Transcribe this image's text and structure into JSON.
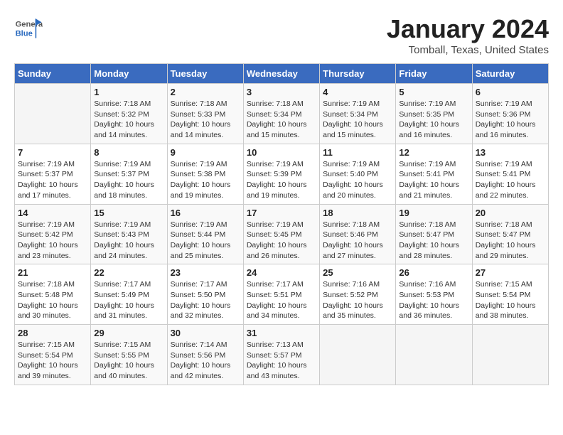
{
  "logo": {
    "text_general": "General",
    "text_blue": "Blue",
    "icon_shape": "flag"
  },
  "header": {
    "month_year": "January 2024",
    "location": "Tomball, Texas, United States"
  },
  "weekdays": [
    "Sunday",
    "Monday",
    "Tuesday",
    "Wednesday",
    "Thursday",
    "Friday",
    "Saturday"
  ],
  "weeks": [
    [
      {
        "day": "",
        "sunrise": "",
        "sunset": "",
        "daylight": ""
      },
      {
        "day": "1",
        "sunrise": "Sunrise: 7:18 AM",
        "sunset": "Sunset: 5:32 PM",
        "daylight": "Daylight: 10 hours and 14 minutes."
      },
      {
        "day": "2",
        "sunrise": "Sunrise: 7:18 AM",
        "sunset": "Sunset: 5:33 PM",
        "daylight": "Daylight: 10 hours and 14 minutes."
      },
      {
        "day": "3",
        "sunrise": "Sunrise: 7:18 AM",
        "sunset": "Sunset: 5:34 PM",
        "daylight": "Daylight: 10 hours and 15 minutes."
      },
      {
        "day": "4",
        "sunrise": "Sunrise: 7:19 AM",
        "sunset": "Sunset: 5:34 PM",
        "daylight": "Daylight: 10 hours and 15 minutes."
      },
      {
        "day": "5",
        "sunrise": "Sunrise: 7:19 AM",
        "sunset": "Sunset: 5:35 PM",
        "daylight": "Daylight: 10 hours and 16 minutes."
      },
      {
        "day": "6",
        "sunrise": "Sunrise: 7:19 AM",
        "sunset": "Sunset: 5:36 PM",
        "daylight": "Daylight: 10 hours and 16 minutes."
      }
    ],
    [
      {
        "day": "7",
        "sunrise": "Sunrise: 7:19 AM",
        "sunset": "Sunset: 5:37 PM",
        "daylight": "Daylight: 10 hours and 17 minutes."
      },
      {
        "day": "8",
        "sunrise": "Sunrise: 7:19 AM",
        "sunset": "Sunset: 5:37 PM",
        "daylight": "Daylight: 10 hours and 18 minutes."
      },
      {
        "day": "9",
        "sunrise": "Sunrise: 7:19 AM",
        "sunset": "Sunset: 5:38 PM",
        "daylight": "Daylight: 10 hours and 19 minutes."
      },
      {
        "day": "10",
        "sunrise": "Sunrise: 7:19 AM",
        "sunset": "Sunset: 5:39 PM",
        "daylight": "Daylight: 10 hours and 19 minutes."
      },
      {
        "day": "11",
        "sunrise": "Sunrise: 7:19 AM",
        "sunset": "Sunset: 5:40 PM",
        "daylight": "Daylight: 10 hours and 20 minutes."
      },
      {
        "day": "12",
        "sunrise": "Sunrise: 7:19 AM",
        "sunset": "Sunset: 5:41 PM",
        "daylight": "Daylight: 10 hours and 21 minutes."
      },
      {
        "day": "13",
        "sunrise": "Sunrise: 7:19 AM",
        "sunset": "Sunset: 5:41 PM",
        "daylight": "Daylight: 10 hours and 22 minutes."
      }
    ],
    [
      {
        "day": "14",
        "sunrise": "Sunrise: 7:19 AM",
        "sunset": "Sunset: 5:42 PM",
        "daylight": "Daylight: 10 hours and 23 minutes."
      },
      {
        "day": "15",
        "sunrise": "Sunrise: 7:19 AM",
        "sunset": "Sunset: 5:43 PM",
        "daylight": "Daylight: 10 hours and 24 minutes."
      },
      {
        "day": "16",
        "sunrise": "Sunrise: 7:19 AM",
        "sunset": "Sunset: 5:44 PM",
        "daylight": "Daylight: 10 hours and 25 minutes."
      },
      {
        "day": "17",
        "sunrise": "Sunrise: 7:19 AM",
        "sunset": "Sunset: 5:45 PM",
        "daylight": "Daylight: 10 hours and 26 minutes."
      },
      {
        "day": "18",
        "sunrise": "Sunrise: 7:18 AM",
        "sunset": "Sunset: 5:46 PM",
        "daylight": "Daylight: 10 hours and 27 minutes."
      },
      {
        "day": "19",
        "sunrise": "Sunrise: 7:18 AM",
        "sunset": "Sunset: 5:47 PM",
        "daylight": "Daylight: 10 hours and 28 minutes."
      },
      {
        "day": "20",
        "sunrise": "Sunrise: 7:18 AM",
        "sunset": "Sunset: 5:47 PM",
        "daylight": "Daylight: 10 hours and 29 minutes."
      }
    ],
    [
      {
        "day": "21",
        "sunrise": "Sunrise: 7:18 AM",
        "sunset": "Sunset: 5:48 PM",
        "daylight": "Daylight: 10 hours and 30 minutes."
      },
      {
        "day": "22",
        "sunrise": "Sunrise: 7:17 AM",
        "sunset": "Sunset: 5:49 PM",
        "daylight": "Daylight: 10 hours and 31 minutes."
      },
      {
        "day": "23",
        "sunrise": "Sunrise: 7:17 AM",
        "sunset": "Sunset: 5:50 PM",
        "daylight": "Daylight: 10 hours and 32 minutes."
      },
      {
        "day": "24",
        "sunrise": "Sunrise: 7:17 AM",
        "sunset": "Sunset: 5:51 PM",
        "daylight": "Daylight: 10 hours and 34 minutes."
      },
      {
        "day": "25",
        "sunrise": "Sunrise: 7:16 AM",
        "sunset": "Sunset: 5:52 PM",
        "daylight": "Daylight: 10 hours and 35 minutes."
      },
      {
        "day": "26",
        "sunrise": "Sunrise: 7:16 AM",
        "sunset": "Sunset: 5:53 PM",
        "daylight": "Daylight: 10 hours and 36 minutes."
      },
      {
        "day": "27",
        "sunrise": "Sunrise: 7:15 AM",
        "sunset": "Sunset: 5:54 PM",
        "daylight": "Daylight: 10 hours and 38 minutes."
      }
    ],
    [
      {
        "day": "28",
        "sunrise": "Sunrise: 7:15 AM",
        "sunset": "Sunset: 5:54 PM",
        "daylight": "Daylight: 10 hours and 39 minutes."
      },
      {
        "day": "29",
        "sunrise": "Sunrise: 7:15 AM",
        "sunset": "Sunset: 5:55 PM",
        "daylight": "Daylight: 10 hours and 40 minutes."
      },
      {
        "day": "30",
        "sunrise": "Sunrise: 7:14 AM",
        "sunset": "Sunset: 5:56 PM",
        "daylight": "Daylight: 10 hours and 42 minutes."
      },
      {
        "day": "31",
        "sunrise": "Sunrise: 7:13 AM",
        "sunset": "Sunset: 5:57 PM",
        "daylight": "Daylight: 10 hours and 43 minutes."
      },
      {
        "day": "",
        "sunrise": "",
        "sunset": "",
        "daylight": ""
      },
      {
        "day": "",
        "sunrise": "",
        "sunset": "",
        "daylight": ""
      },
      {
        "day": "",
        "sunrise": "",
        "sunset": "",
        "daylight": ""
      }
    ]
  ]
}
